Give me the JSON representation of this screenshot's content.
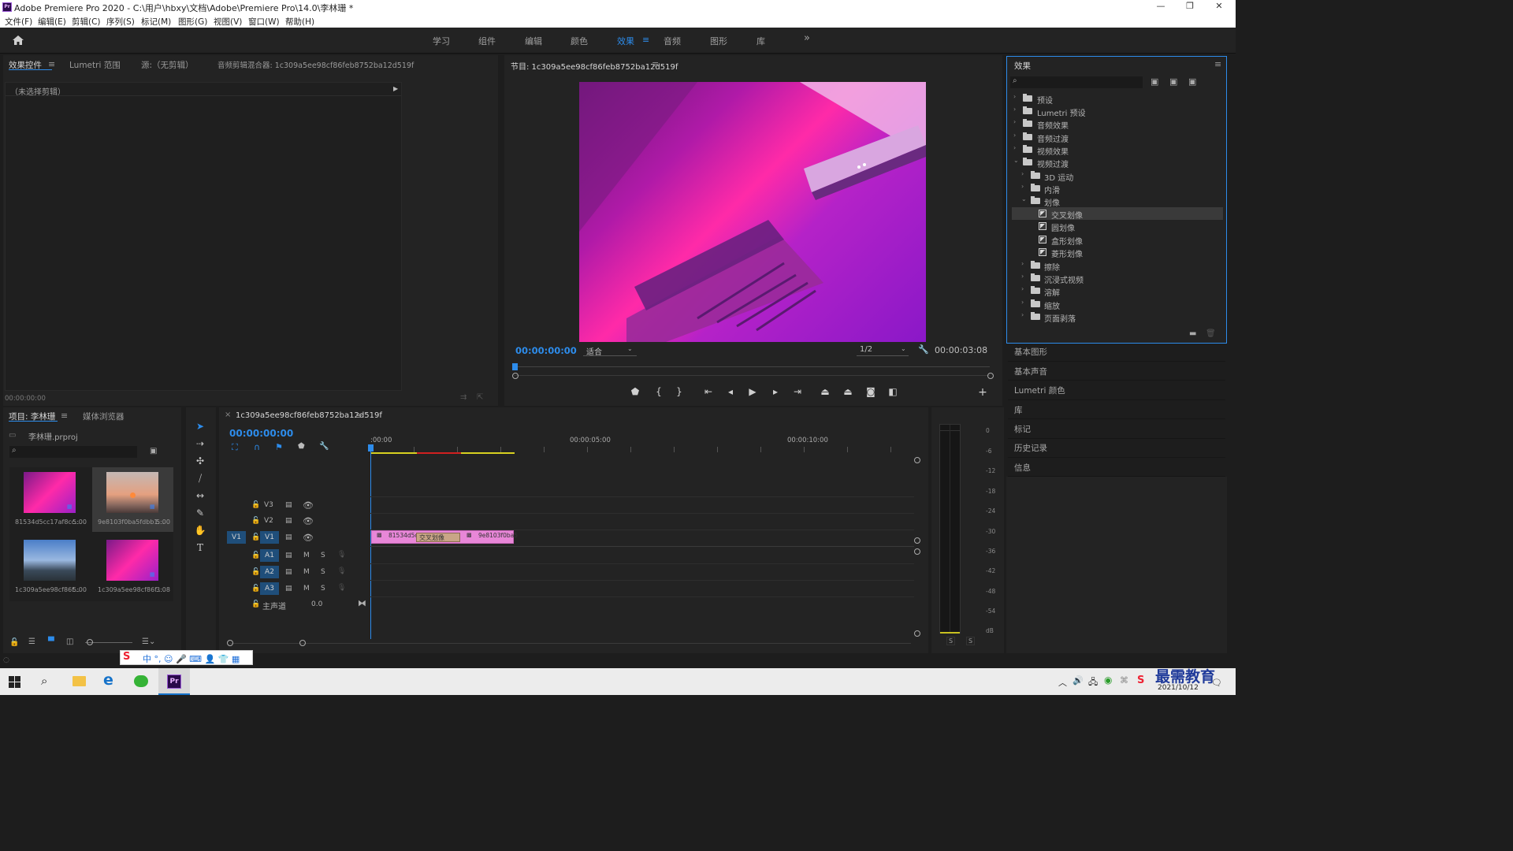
{
  "window": {
    "title": "Adobe Premiere Pro 2020 - C:\\用户\\hbxy\\文档\\Adobe\\Premiere Pro\\14.0\\李林珊 *",
    "logo": "Pr"
  },
  "menu": [
    "文件(F)",
    "编辑(E)",
    "剪辑(C)",
    "序列(S)",
    "标记(M)",
    "图形(G)",
    "视图(V)",
    "窗口(W)",
    "帮助(H)"
  ],
  "workspaces": {
    "items": [
      "学习",
      "组件",
      "编辑",
      "颜色",
      "效果",
      "音频",
      "图形",
      "库"
    ],
    "active": "效果",
    "more": "»"
  },
  "source_panel": {
    "tabs": [
      "效果控件",
      "Lumetri 范围",
      "源:（无剪辑）",
      "音频剪辑混合器: 1c309a5ee98cf86feb8752ba12d519f"
    ],
    "no_clip": "（未选择剪辑）",
    "timecode": "00:00:00:00"
  },
  "program_monitor": {
    "title": "节目: 1c309a5ee98cf86feb8752ba12d519f",
    "timecode": "00:00:00:00",
    "fit": "适合",
    "resolution": "1/2",
    "duration": "00:00:03:08"
  },
  "effects_panel": {
    "title": "效果",
    "tree": [
      {
        "label": "预设",
        "level": 0,
        "open": false,
        "type": "folder-special"
      },
      {
        "label": "Lumetri 预设",
        "level": 0,
        "open": false,
        "type": "folder-special"
      },
      {
        "label": "音频效果",
        "level": 0,
        "open": false,
        "type": "folder"
      },
      {
        "label": "音频过渡",
        "level": 0,
        "open": false,
        "type": "folder"
      },
      {
        "label": "视频效果",
        "level": 0,
        "open": false,
        "type": "folder"
      },
      {
        "label": "视频过渡",
        "level": 0,
        "open": true,
        "type": "folder"
      },
      {
        "label": "3D 运动",
        "level": 1,
        "open": false,
        "type": "folder"
      },
      {
        "label": "内滑",
        "level": 1,
        "open": false,
        "type": "folder"
      },
      {
        "label": "划像",
        "level": 1,
        "open": true,
        "type": "folder"
      },
      {
        "label": "交叉划像",
        "level": 2,
        "type": "effect",
        "selected": true
      },
      {
        "label": "圆划像",
        "level": 2,
        "type": "effect"
      },
      {
        "label": "盒形划像",
        "level": 2,
        "type": "effect"
      },
      {
        "label": "菱形划像",
        "level": 2,
        "type": "effect"
      },
      {
        "label": "擦除",
        "level": 1,
        "open": false,
        "type": "folder"
      },
      {
        "label": "沉浸式视频",
        "level": 1,
        "open": false,
        "type": "folder"
      },
      {
        "label": "溶解",
        "level": 1,
        "open": false,
        "type": "folder"
      },
      {
        "label": "缩放",
        "level": 1,
        "open": false,
        "type": "folder"
      },
      {
        "label": "页面剥落",
        "level": 1,
        "open": false,
        "type": "folder"
      }
    ],
    "side_panels": [
      "基本图形",
      "基本声音",
      "Lumetri 颜色",
      "库",
      "标记",
      "历史记录",
      "信息"
    ]
  },
  "project_panel": {
    "tabs": [
      "项目: 李林珊",
      "媒体浏览器"
    ],
    "file": "李林珊.prproj",
    "items": [
      {
        "name": "81534d5cc17af8cc...",
        "duration": "5:00"
      },
      {
        "name": "9e8103f0ba5fdbb1...",
        "duration": "5:00"
      },
      {
        "name": "1c309a5ee98cf86f...",
        "duration": "5:00"
      },
      {
        "name": "1c309a5ee98cf86f...",
        "duration": "3:08"
      }
    ]
  },
  "timeline": {
    "sequence": "1c309a5ee98cf86feb8752ba12d519f",
    "close": "×",
    "timecode": "00:00:00:00",
    "ruler": [
      ":00:00",
      "00:00:05:00",
      "00:00:10:00"
    ],
    "video_tracks": [
      "V3",
      "V2",
      "V1"
    ],
    "audio_tracks": [
      "A1",
      "A2",
      "A3"
    ],
    "source_patch": "V1",
    "mute": "M",
    "solo": "S",
    "master": {
      "label": "主声道",
      "value": "0.0"
    },
    "clips": [
      {
        "label": "81534d5c",
        "track": "V1"
      },
      {
        "label": "9e8103f0ba5",
        "track": "V1"
      }
    ],
    "transition": "交叉划像"
  },
  "audio_meter": {
    "scale": [
      "0",
      "-6",
      "-12",
      "-18",
      "-24",
      "-30",
      "-36",
      "-42",
      "-48",
      "-54",
      "dB"
    ],
    "solo": [
      "S",
      "S"
    ]
  },
  "taskbar": {
    "date": "2021/10/12",
    "watermark": "最需教育"
  },
  "colors": {
    "accent": "#2d8ceb",
    "clip": "#e887d8",
    "transition": "#c9a586"
  }
}
